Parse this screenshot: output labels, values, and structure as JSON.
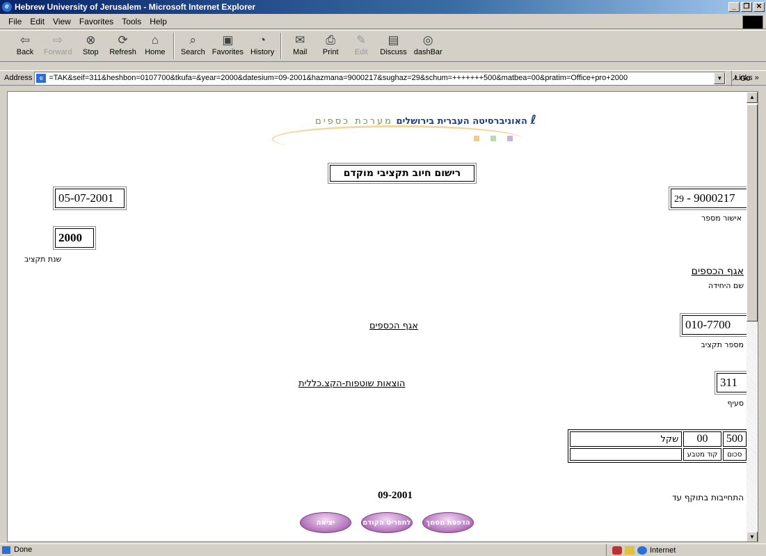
{
  "window": {
    "title": "Hebrew University of Jerusalem - Microsoft Internet Explorer"
  },
  "menu": [
    "File",
    "Edit",
    "View",
    "Favorites",
    "Tools",
    "Help"
  ],
  "toolbar": {
    "back": "Back",
    "forward": "Forward",
    "stop": "Stop",
    "refresh": "Refresh",
    "home": "Home",
    "search": "Search",
    "favorites": "Favorites",
    "history": "History",
    "mail": "Mail",
    "print": "Print",
    "edit": "Edit",
    "discuss": "Discuss",
    "dashbar": "dashBar"
  },
  "address": {
    "label": "Address",
    "url": "=TAK&seif=311&heshbon=0107700&tkufa=&year=2000&datesium=09-2001&hazmana=9000217&sughaz=29&schum=+++++++500&matbea=00&pratim=Office+pro+2000",
    "go": "Go",
    "links": "Links"
  },
  "logo": {
    "university": "האוניברסיטה העברית בירושלים",
    "system": "מערכת כספים"
  },
  "form": {
    "title": "רישום חיוב תקציבי מוקדם",
    "date": "05-07-2001",
    "approval_type": "29",
    "approval_sep": " - ",
    "approval_number": "9000217",
    "approval_label": "אישור מספר",
    "year": "2000",
    "year_label": "שנת תקציב",
    "unit_name": "אגף הכספים",
    "unit_label": "שם היחידה",
    "budget_number": "010-7700",
    "budget_number_label": "מספר תקציב",
    "budget_name": "אגף הכספים",
    "section": "311",
    "section_label": "סעיף",
    "section_name": "הוצאות שוטפות-הקצ.כללית",
    "amount": "500",
    "currency_code": "00",
    "currency_name": "שקל",
    "amount_label": "סכום",
    "currency_code_label": "קוד מטבע",
    "valid_until_label": "התחייבות בתוקף עד",
    "valid_until": "09-2001"
  },
  "buttons": {
    "exit": "יציאה",
    "prev_menu": "לתפריט הקודם",
    "print_doc": "הדפסת מסמך"
  },
  "status": {
    "text": "Done",
    "zone": "Internet"
  }
}
